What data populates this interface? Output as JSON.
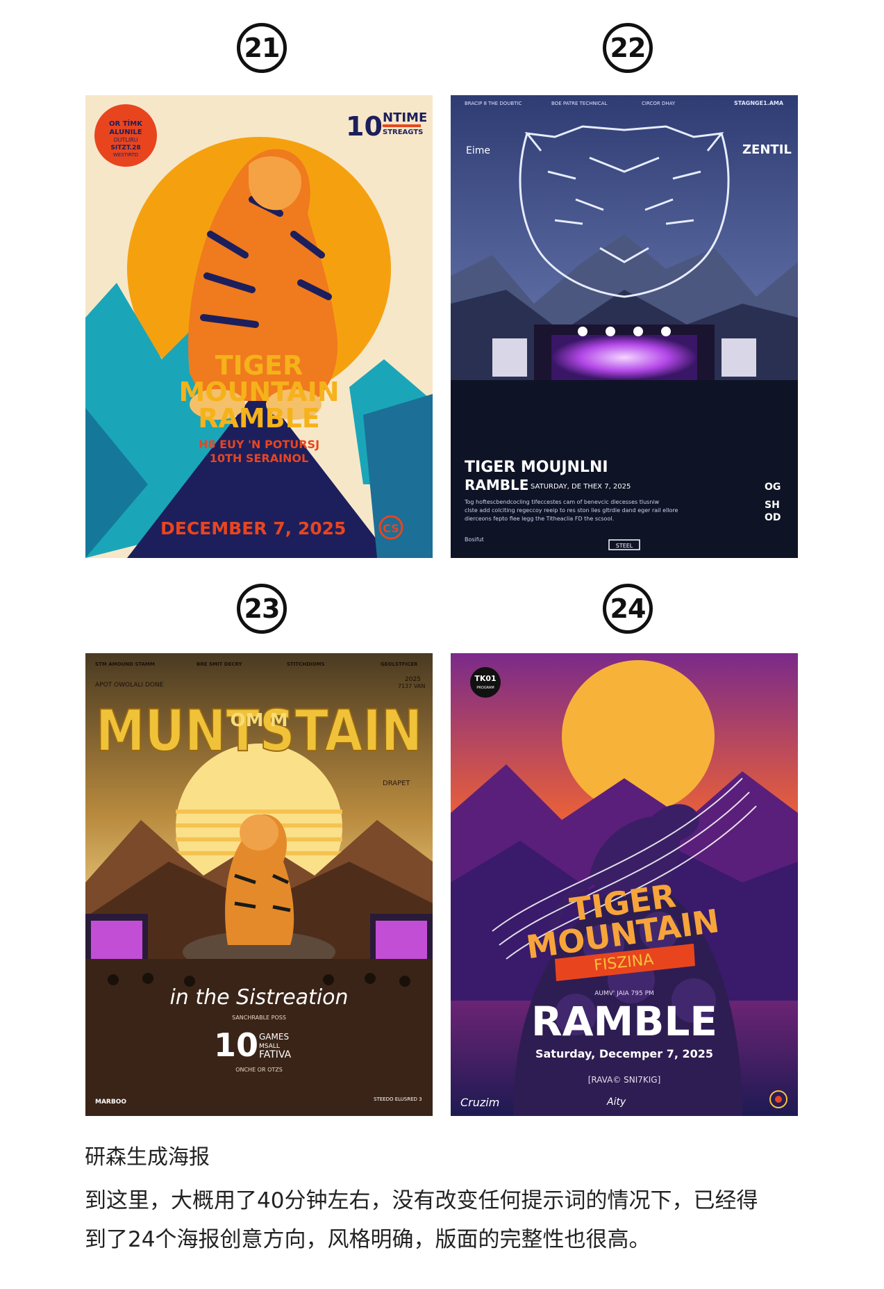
{
  "badges": [
    "21",
    "22",
    "23",
    "24"
  ],
  "posters": {
    "p21": {
      "corner_text": [
        "OR TİMK",
        "ALUNILE",
        "OUTLIRU",
        "SITZT.28",
        "WESTIRTD"
      ],
      "badge_num": "10",
      "badge_word": "NTIME",
      "badge_sub": "STREAGTS",
      "title1": "TIGER",
      "title2": "MOUNTAIN",
      "title3": "RAMBLE",
      "sub1": "H8 EUY 'N POTURSJ",
      "sub2": "10TH SERAINOL",
      "date": "DECEMBER 7, 2025",
      "logo": "CS"
    },
    "p22": {
      "top_left": "BRACIP 8 THE DOUBTIC",
      "top_mid1": "BOE PATRE TECHNICAL",
      "top_mid2": "CIRCOR DHAY",
      "top_right": "STAGNGE1.AMA",
      "brand_left": "Eime",
      "brand_right": "ZENTIL",
      "title1": "TIGER MOUJNLNI",
      "title2": "RAMBLE",
      "title2_small": "SATURDAY, DE THEX 7, 2025",
      "body1": "Tog hoftescbendcocling tifeccestes cam of benevcic diecesses tlusniw",
      "body2": "clste add colciting regeccoy reeip to res ston lies gltrdie dand eger rail ellore",
      "body3": "dierceons fepto flee legg the Titheaclia FD the scsool.",
      "side1": "OG",
      "side2": "SH",
      "side3": "OD",
      "foot_left": "Bosifut",
      "foot_logo": "STEEL"
    },
    "p23": {
      "top1": "STM AMOUND STAMM",
      "top2": "BRE SMIT DECRY",
      "top3": "STITCHDIOMS",
      "top4": "GEOLSTFICER",
      "sub_left": "APOT OWOLALI DONE",
      "year": "2025",
      "year_sub": "7137 VAN",
      "title": "MUNTSTAIN",
      "overlay": "OM M",
      "side_right": "DRAPET",
      "script": "in the Sistreation",
      "tag": "SANCHRABLE POSS",
      "big_num": "10",
      "games1": "GAMES",
      "games2": "MSALL",
      "games3": "FATIVA",
      "tag2": "ONCHE OR OTZS",
      "foot_left": "MARBOO",
      "foot_right": "STEEDO ELUSRED 3"
    },
    "p24": {
      "corner_top": "TK01",
      "corner_sub": "PROGRAM",
      "title1": "TIGER",
      "title2": "MOUNTAIN",
      "ribbon": "FISZINA",
      "small": "AUMV' JAIA 795 PM",
      "title3": "RAMBLE",
      "date": "Saturday, Decemper 7, 2025",
      "foot_mid": "[RAVA© SNI7KIG]",
      "sign_left": "Cruzim",
      "sign_mid": "Aity"
    }
  },
  "caption": "研森生成海报",
  "paragraph": [
    "到这里，大概用了40分钟左右，没有改变任何提示词的情况下，已经得",
    "到了24个海报创意方向，风格明确，版面的完整性也很高。"
  ],
  "colors": {
    "p21_bg": "#f7e7c9",
    "p21_sun": "#f5a10f",
    "p21_navy": "#1c1f5c",
    "p22_sky": "#2f3c73",
    "p23_gold": "#f0c23a",
    "p24_purple": "#5a1f7a"
  }
}
